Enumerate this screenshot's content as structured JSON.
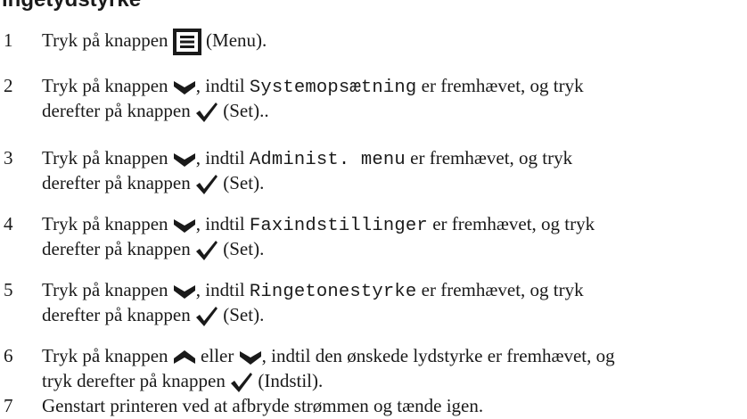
{
  "heading": "ingetydstyrke",
  "steps": [
    {
      "num": "1",
      "a": "Tryk på knappen",
      "b": "(Menu)."
    },
    {
      "num": "2",
      "a": "Tryk på knappen",
      "b": ", indtil",
      "item": "Systemopsætning",
      "c": "er fremhævet, og tryk",
      "d": "derefter på knappen",
      "e": "(Set).."
    },
    {
      "num": "3",
      "a": "Tryk på knappen",
      "b": ", indtil",
      "item": "Administ. menu",
      "c": "er fremhævet, og tryk",
      "d": "derefter på knappen",
      "e": "(Set)."
    },
    {
      "num": "4",
      "a": "Tryk på knappen",
      "b": ", indtil",
      "item": "Faxindstillinger",
      "c": "er fremhævet, og tryk",
      "d": "derefter på knappen",
      "e": "(Set)."
    },
    {
      "num": "5",
      "a": "Tryk på knappen",
      "b": ", indtil",
      "item": "Ringetonestyrke",
      "c": "er fremhævet, og tryk",
      "d": "derefter på knappen",
      "e": "(Set)."
    },
    {
      "num": "6",
      "a": "Tryk på knappen",
      "or": "eller",
      "b": ", indtil den ønskede lydstyrke er fremhævet, og",
      "d": "tryk derefter på knappen",
      "e": "(Indstil)."
    },
    {
      "num": "7",
      "a": "Genstart printeren ved at afbryde strømmen og tænde igen."
    }
  ],
  "icons": {
    "menu": "menu-button-icon",
    "down": "down-arrow-button-icon",
    "up": "up-arrow-button-icon",
    "set": "checkmark-set-icon"
  }
}
